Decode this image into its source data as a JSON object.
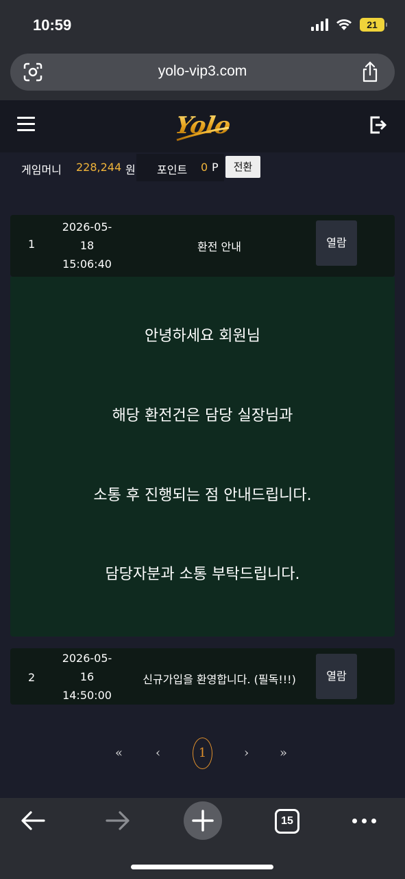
{
  "status_bar": {
    "time": "10:59",
    "battery": "21",
    "icons": [
      "cellular-signal-icon",
      "wifi-icon",
      "battery-icon"
    ]
  },
  "browser": {
    "url": "yolo-vip3.com",
    "left_icon": "lens-camera-icon",
    "right_icon": "share-icon",
    "tab_count": "15",
    "toolbar_icons": [
      "back-arrow-icon",
      "forward-arrow-icon",
      "plus-icon",
      "tabs-icon",
      "more-icon"
    ]
  },
  "header": {
    "logo_text": "Yolo",
    "menu_icon": "hamburger-menu-icon",
    "logout_icon": "logout-icon"
  },
  "account": {
    "money_label": "게임머니",
    "money_value": "228,244",
    "money_unit": "원",
    "point_label": "포인트",
    "point_value": "0",
    "point_unit": "P",
    "convert_label": "전환"
  },
  "notices": [
    {
      "number": "1",
      "date_lines": [
        "2026-05-",
        "18",
        "15:06:40"
      ],
      "title": "환전 안내",
      "button": "열람",
      "expanded": true,
      "content_lines": [
        "안녕하세요 회원님",
        "해당 환전건은 담당 실장님과",
        "소통 후 진행되는 점 안내드립니다.",
        "담당자분과 소통 부탁드립니다."
      ]
    },
    {
      "number": "2",
      "date_lines": [
        "2026-05-",
        "16",
        "14:50:00"
      ],
      "title": "신규가입을 환영합니다. (필독!!!)",
      "button": "열람",
      "expanded": false
    }
  ],
  "pagination": {
    "first": "«",
    "prev": "‹",
    "current": "1",
    "next": "›",
    "last": "»"
  },
  "colors": {
    "background": "#1b1d2a",
    "accent_gold": "#f0b43a",
    "pagination_accent": "#e0902c",
    "notice_row_bg": "#0f1a16",
    "notice_content_bg": "#0f2a1f"
  }
}
